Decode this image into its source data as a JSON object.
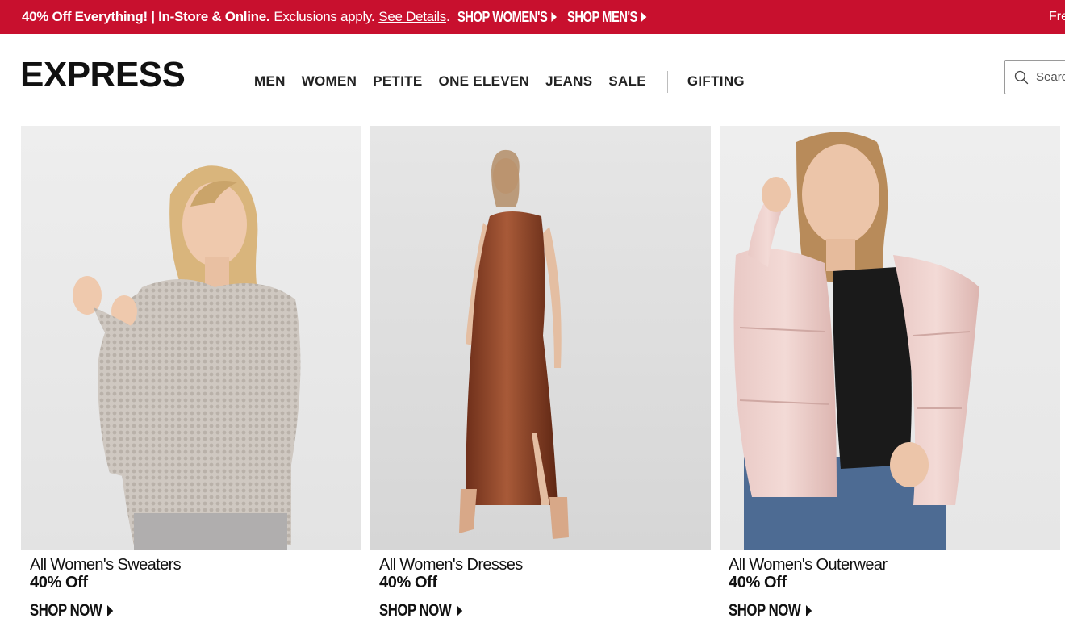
{
  "promo": {
    "headline": "40% Off Everything! | In-Store & Online.",
    "exclusions": "Exclusions apply.",
    "details_link": "See Details",
    "period": ".",
    "shop_women": "SHOP WOMEN'S",
    "shop_men": "SHOP MEN'S",
    "right_text": "Fre"
  },
  "header": {
    "logo": "EXPRESS",
    "nav": [
      "MEN",
      "WOMEN",
      "PETITE",
      "ONE ELEVEN",
      "JEANS",
      "SALE"
    ],
    "nav_gifting": "GIFTING",
    "search_placeholder": "Search"
  },
  "cards": [
    {
      "title": "All Women's Sweaters",
      "offer": "40% Off",
      "cta": "SHOP NOW"
    },
    {
      "title": "All Women's Dresses",
      "offer": "40% Off",
      "cta": "SHOP NOW"
    },
    {
      "title": "All Women's Outerwear",
      "offer": "40% Off",
      "cta": "SHOP NOW"
    }
  ],
  "colors": {
    "brand_red": "#c8102e",
    "text": "#111111"
  }
}
